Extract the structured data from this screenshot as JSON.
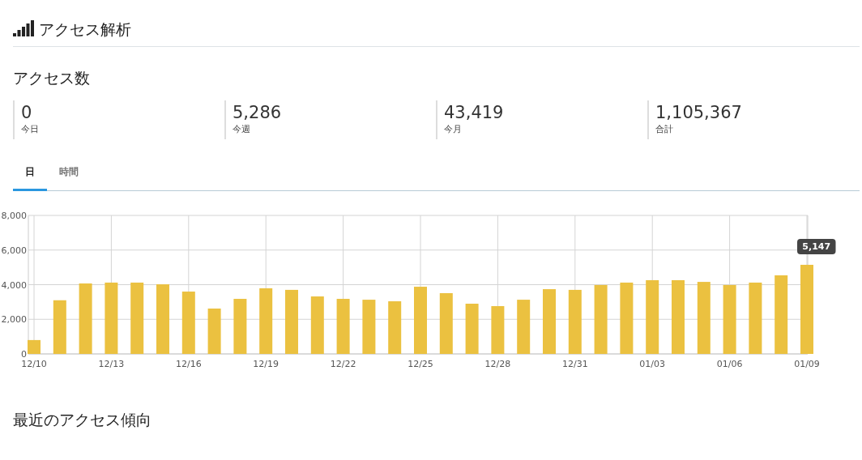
{
  "header": {
    "title": "アクセス解析"
  },
  "access": {
    "title": "アクセス数",
    "stats": [
      {
        "value": "0",
        "label": "今日"
      },
      {
        "value": "5,286",
        "label": "今週"
      },
      {
        "value": "43,419",
        "label": "今月"
      },
      {
        "value": "1,105,367",
        "label": "合計"
      }
    ],
    "tabs": [
      {
        "label": "日",
        "selected": true
      },
      {
        "label": "時間",
        "selected": false
      }
    ],
    "chart_data": {
      "type": "bar",
      "categories": [
        "12/10",
        null,
        null,
        "12/13",
        null,
        null,
        "12/16",
        null,
        null,
        "12/19",
        null,
        null,
        "12/22",
        null,
        null,
        "12/25",
        null,
        null,
        "12/28",
        null,
        null,
        "12/31",
        null,
        null,
        "01/03",
        null,
        null,
        "01/06",
        null,
        null,
        "01/09"
      ],
      "grid": true,
      "series": [
        {
          "color": "#ebc140",
          "values": [
            800,
            3100,
            4070,
            4120,
            4120,
            4020,
            3600,
            2620,
            3180,
            3790,
            3700,
            3320,
            3180,
            3130,
            3040,
            3880,
            3510,
            2900,
            2760,
            3130,
            3740,
            3700,
            3980,
            4120,
            4260,
            4260,
            4160,
            3980,
            4120,
            4540,
            5147
          ]
        }
      ],
      "ylim": [
        0,
        8000
      ],
      "yticks": [
        {
          "value": 0,
          "label": "0"
        },
        {
          "value": 2000,
          "label": "2,000"
        },
        {
          "value": 4000,
          "label": "4,000"
        },
        {
          "value": 6000,
          "label": "6,000"
        },
        {
          "value": 8000,
          "label": "8,000"
        }
      ],
      "annotations": [
        {
          "x": "01/09",
          "y": 5147,
          "text": "5,147"
        }
      ]
    }
  },
  "trend": {
    "title": "最近のアクセス傾向"
  }
}
